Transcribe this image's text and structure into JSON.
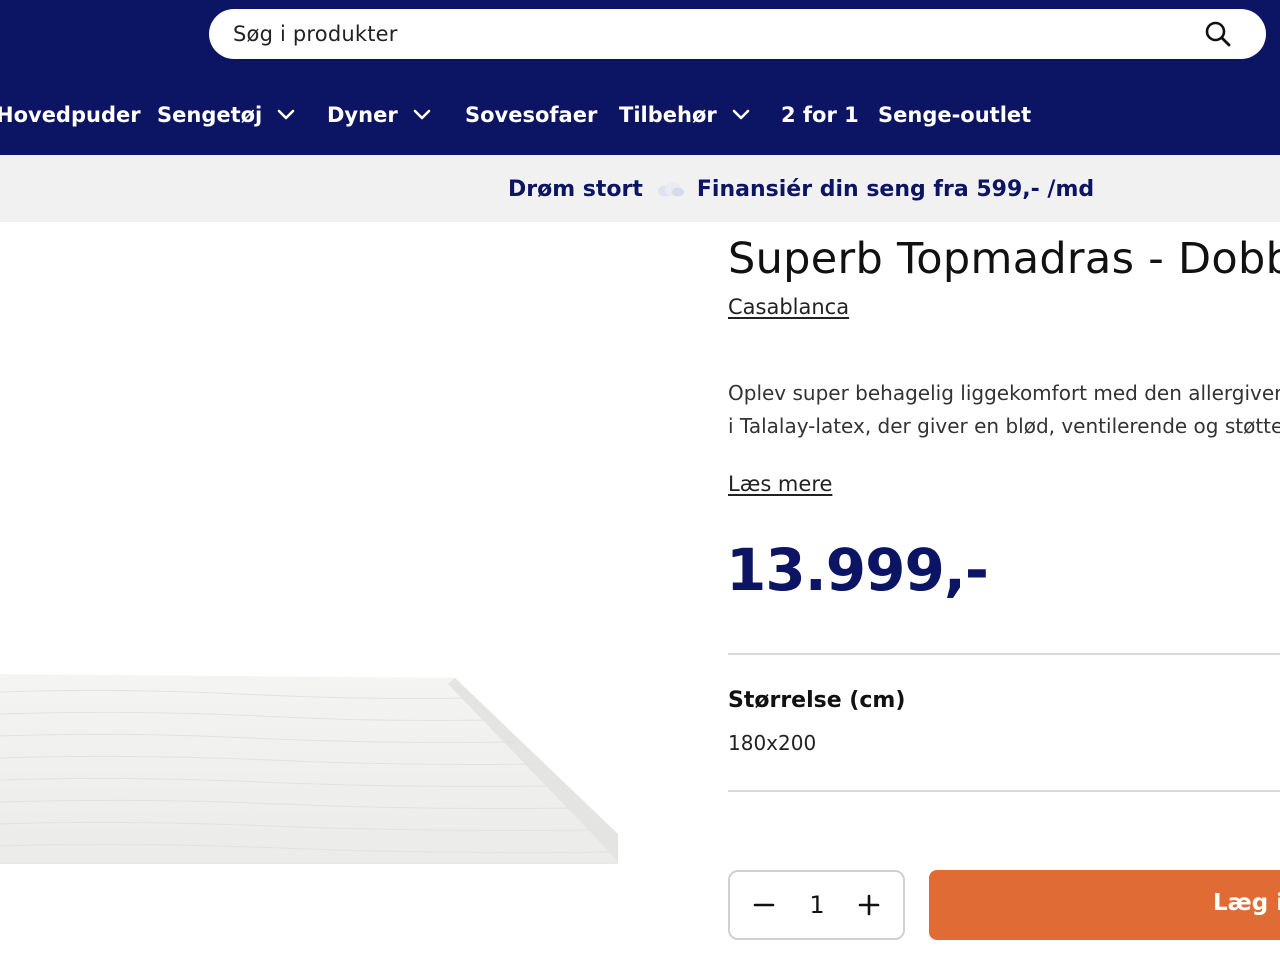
{
  "header": {
    "search": {
      "placeholder": "Søg i produkter"
    },
    "nav": [
      {
        "label": "Hovedpuder",
        "has_dropdown": false
      },
      {
        "label": "Sengetøj",
        "has_dropdown": true
      },
      {
        "label": "Dyner",
        "has_dropdown": true
      },
      {
        "label": "Sovesofaer",
        "has_dropdown": false
      },
      {
        "label": "Tilbehør",
        "has_dropdown": true
      },
      {
        "label": "2 for 1",
        "has_dropdown": false
      },
      {
        "label": "Senge-outlet",
        "has_dropdown": false
      }
    ]
  },
  "promo": {
    "left_text": "Drøm stort",
    "right_text": "Finansiér din seng fra 599,- /md",
    "icon": "cloud-icon"
  },
  "product": {
    "title": "Superb Topmadras - Dobbe",
    "brand": "Casablanca",
    "description_lines": [
      "Oplev super behagelig liggekomfort med den allergiver",
      "i Talalay-latex, der giver en blød, ventilerende og støtte"
    ],
    "read_more": "Læs mere",
    "price": "13.999,-",
    "size_label": "Størrelse (cm)",
    "size_value": "180x200",
    "quantity": "1",
    "add_to_cart": "Læg i"
  },
  "colors": {
    "brand_navy": "#0c1464",
    "cta_orange": "#e06b34",
    "promo_bg": "#f2f1f1"
  }
}
